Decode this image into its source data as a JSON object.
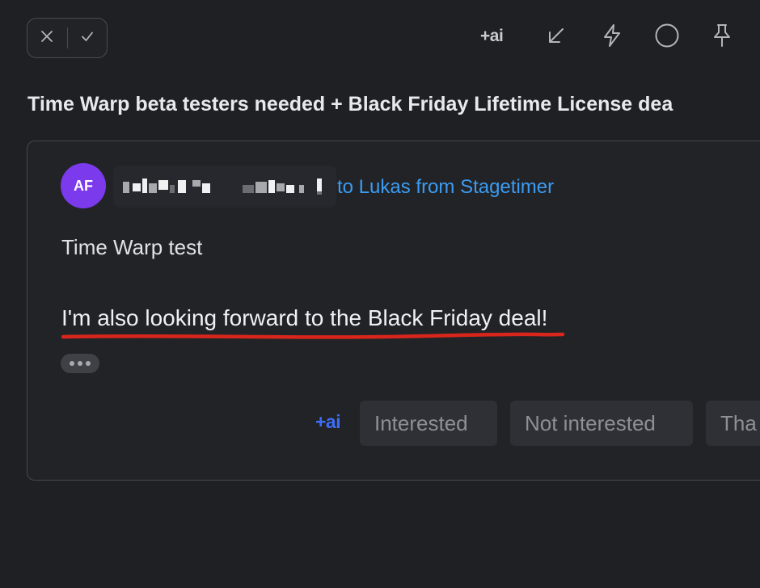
{
  "toolbar": {
    "ai_label": "+ai",
    "icons": [
      "close-icon",
      "check-icon",
      "ai-icon",
      "arrow-down-left-icon",
      "lightning-icon",
      "circle-icon",
      "pin-icon"
    ]
  },
  "subject": "Time Warp beta testers needed + Black Friday Lifetime License dea",
  "message": {
    "avatar_initials": "AF",
    "to_line": "to Lukas from Stagetimer",
    "body_line1": "Time Warp test",
    "body_line2": "I'm also looking forward to the Black Friday deal!"
  },
  "quick_replies": {
    "ai_label": "+ai",
    "options": [
      "Interested",
      "Not interested",
      "Tha"
    ]
  },
  "colors": {
    "background": "#1f2024",
    "avatar": "#7c3aed",
    "link": "#3b9cf2",
    "ai_accent": "#3e6df5",
    "underline": "#d9261c"
  }
}
